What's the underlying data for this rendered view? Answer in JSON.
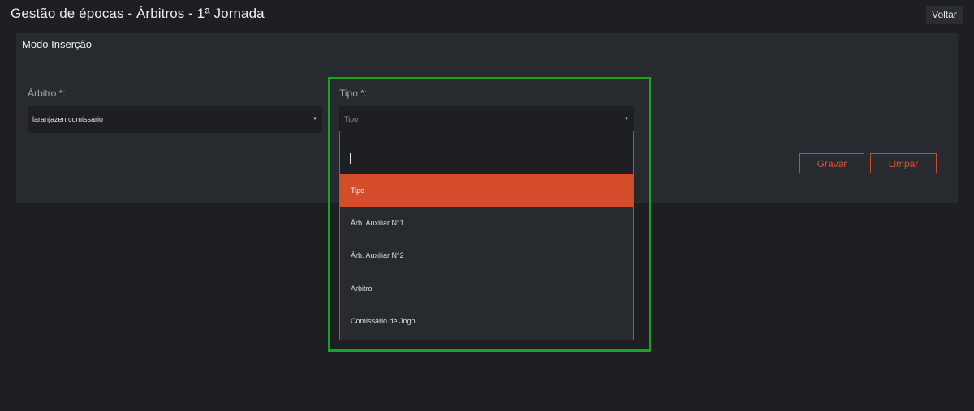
{
  "header": {
    "title": "Gestão de épocas - Árbitros - 1ª Jornada",
    "back_label": "Voltar"
  },
  "panel": {
    "title": "Modo Inserção"
  },
  "form": {
    "arbitro": {
      "label": "Árbitro *:",
      "value": "laranjazen comissário"
    },
    "tipo": {
      "label": "Tipo *:",
      "placeholder": "Tipo",
      "search_value": "",
      "options": [
        "Tipo",
        "Árb. Auxiliar N°1",
        "Árb. Auxiliar N°2",
        "Árbitro",
        "Comissário de Jogo"
      ],
      "selected_index": 0
    }
  },
  "actions": {
    "save_label": "Gravar",
    "clear_label": "Limpar"
  },
  "colors": {
    "accent": "#d44c29",
    "highlight": "#16a521",
    "background": "#1d1f22",
    "panel": "#272a2e"
  }
}
